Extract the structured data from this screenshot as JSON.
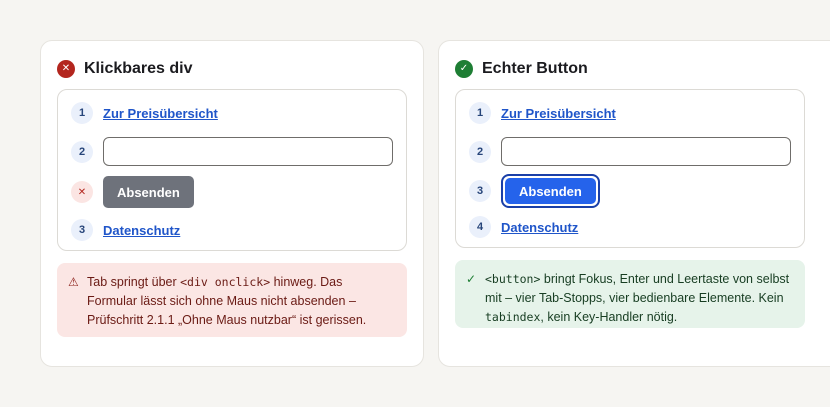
{
  "bad": {
    "title": "Klickbares div",
    "status_glyph": "✕",
    "rows": [
      {
        "num": "1",
        "link": "Zur Preisübersicht"
      },
      {
        "num": "2"
      },
      {
        "num": "✕",
        "button": "Absenden"
      },
      {
        "num": "3",
        "link": "Datenschutz"
      }
    ],
    "note": {
      "icon": "⚠",
      "pre": "Tab springt über ",
      "code": "<div onclick>",
      "post": " hinweg. Das Formular lässt sich ohne Maus nicht absenden – Prüfschritt 2.1.1 „Ohne Maus nutzbar“ ist gerissen."
    }
  },
  "good": {
    "title": "Echter Button",
    "status_glyph": "✓",
    "rows": [
      {
        "num": "1",
        "link": "Zur Preisübersicht"
      },
      {
        "num": "2"
      },
      {
        "num": "3",
        "button": "Absenden"
      },
      {
        "num": "4",
        "link": "Datenschutz"
      }
    ],
    "note": {
      "icon": "✓",
      "code1": "<button>",
      "mid": " bringt Fokus, Enter und Leertaste von selbst mit – vier Tab-Stopps, vier bedienbare Elemente. Kein ",
      "code2": "tabindex",
      "post": ", kein Key-Handler nötig."
    }
  },
  "colors": {
    "bad": "#b3261e",
    "good": "#1e7e34",
    "link": "#1f55c9",
    "focus_ring": "#1a3fa8"
  }
}
